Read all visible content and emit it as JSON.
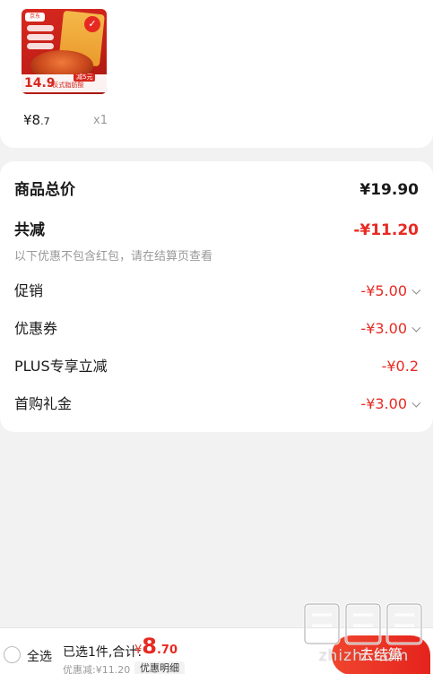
{
  "product": {
    "thumb_logo": "京东",
    "thumb_price": "14.9",
    "thumb_sub": "0反式脂肪酸",
    "thumb_save": "减5元",
    "price_symbol": "¥",
    "price_int": "8",
    "price_dec": ".7",
    "qty": "x1"
  },
  "summary": {
    "total_label": "商品总价",
    "total_value": "¥19.90",
    "reduce_label": "共减",
    "reduce_value": "-¥11.20",
    "note": "以下优惠不包含红包，请在结算页查看",
    "items": [
      {
        "label": "促销",
        "value": "-¥5.00"
      },
      {
        "label": "优惠券",
        "value": "-¥3.00"
      },
      {
        "label": "PLUS专享立减",
        "value": "-¥0.2"
      },
      {
        "label": "首购礼金",
        "value": "-¥3.00"
      }
    ]
  },
  "bottom": {
    "select_all": "全选",
    "selected_text": "已选1件,合计:",
    "total_symbol": "¥",
    "total_int": "8",
    "total_dec": ".70",
    "discount_text": "优惠减:¥11.20",
    "detail_button": "优惠明细",
    "checkout_button": "去结算"
  },
  "watermark": {
    "logo_text": "值",
    "site": "zhizhi.com"
  },
  "colors": {
    "accent": "#e62a22",
    "background": "#f2f2f2"
  }
}
